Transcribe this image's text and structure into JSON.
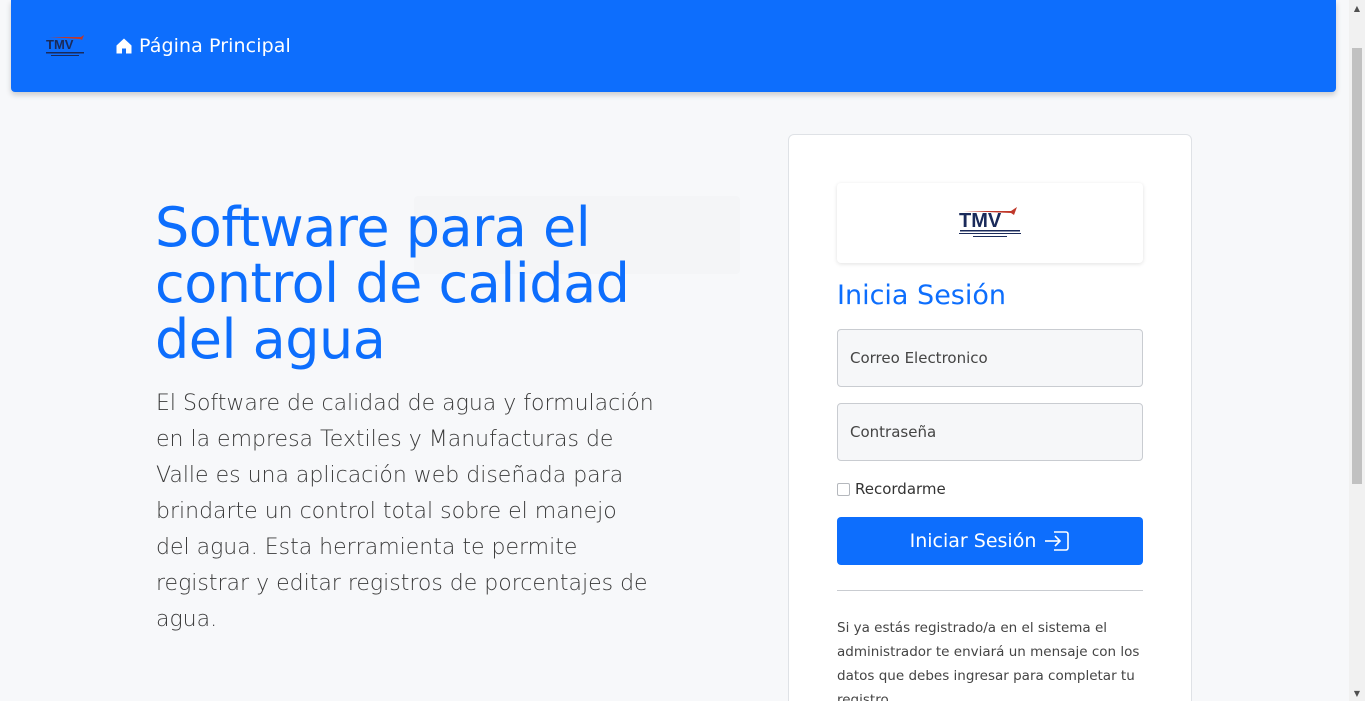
{
  "navbar": {
    "brand_logo_text": "TMV",
    "home_label": "Página Principal"
  },
  "hero": {
    "title": "Software para el control de calidad del agua",
    "description": "El Software de calidad de agua y formulación en la empresa Textiles y Manufacturas de Valle es una aplicación web diseñada para brindarte un control total sobre el manejo del agua. Esta herramienta te permite registrar y editar registros de porcentajes de agua."
  },
  "login": {
    "logo_text": "TMV",
    "title": "Inicia Sesión",
    "email_placeholder": "Correo Electronico",
    "password_placeholder": "Contraseña",
    "remember_label": "Recordarme",
    "submit_label": "Iniciar Sesión",
    "note": "Si ya estás registrado/a en el sistema el administrador te enviará un mensaje con los datos que debes ingresar para completar tu registro."
  },
  "colors": {
    "primary": "#0d6efd",
    "background": "#f7f8fa"
  },
  "icons": {
    "home": "home-icon",
    "login": "login-icon"
  }
}
